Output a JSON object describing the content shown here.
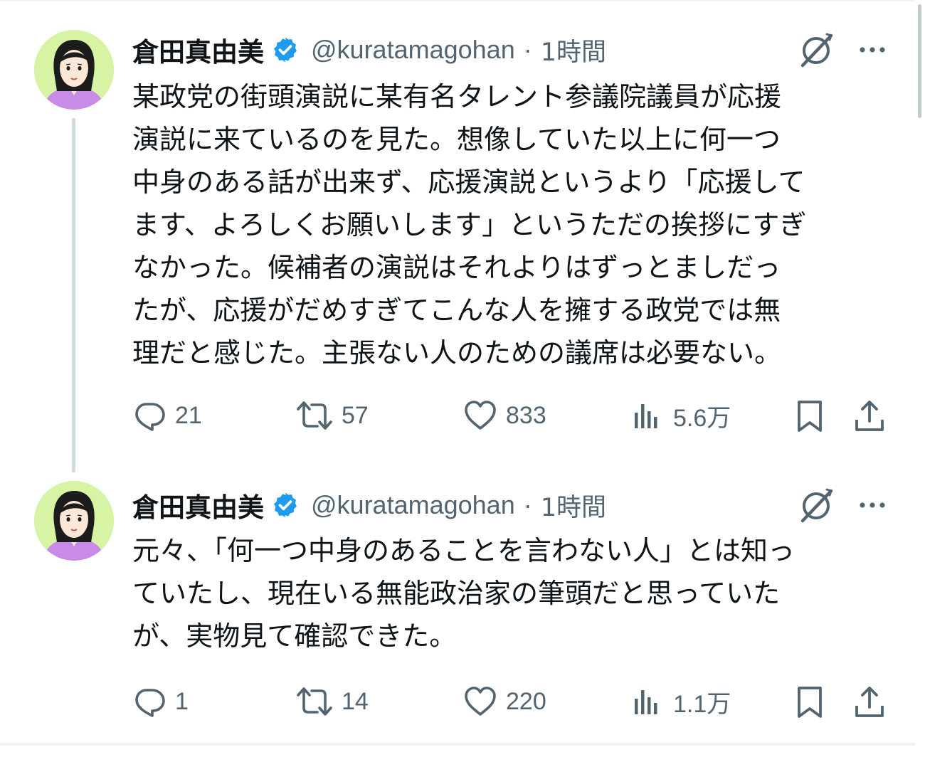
{
  "colors": {
    "text_primary": "#0f1419",
    "text_secondary": "#536471",
    "verified_blue": "#1d9bf0",
    "thread_line": "#cfd9de",
    "avatar_bg": "#d7f4a4",
    "avatar_shirt": "#c98be8"
  },
  "tweets": [
    {
      "display_name": "倉田真由美",
      "handle": "@kuratamagohan",
      "separator": "·",
      "time": "1時間",
      "avatar_icon": "user-avatar-illustration",
      "verified_icon": "verified-badge-icon",
      "body_lines": [
        "某政党の街頭演説に某有名タレント参議院議員が応援",
        "演説に来ているのを見た。想像していた以上に何一つ",
        "中身のある話が出来ず、応援演説というより「応援して",
        "ます、よろしくお願いします」というただの挨拶にすぎ",
        "なかった。候補者の演説はそれよりはずっとましだっ",
        "たが、応援がだめすぎてこんな人を擁する政党では無",
        "理だと感じた。主張ない人のための議席は必要ない。"
      ],
      "actions": {
        "replies": "21",
        "retweets": "57",
        "likes": "833",
        "views": "5.6万"
      }
    },
    {
      "display_name": "倉田真由美",
      "handle": "@kuratamagohan",
      "separator": "·",
      "time": "1時間",
      "avatar_icon": "user-avatar-illustration",
      "verified_icon": "verified-badge-icon",
      "body_lines": [
        "元々、「何一つ中身のあることを言わない人」とは知っ",
        "ていたし、現在いる無能政治家の筆頭だと思っていた",
        "が、実物見て確認できた。"
      ],
      "actions": {
        "replies": "1",
        "retweets": "14",
        "likes": "220",
        "views": "1.1万"
      }
    }
  ],
  "icons": {
    "grok": "grok-icon",
    "more": "more-dots-icon",
    "reply": "reply-icon",
    "retweet": "retweet-icon",
    "like": "heart-icon",
    "views": "views-chart-icon",
    "bookmark": "bookmark-icon",
    "share": "share-icon"
  }
}
